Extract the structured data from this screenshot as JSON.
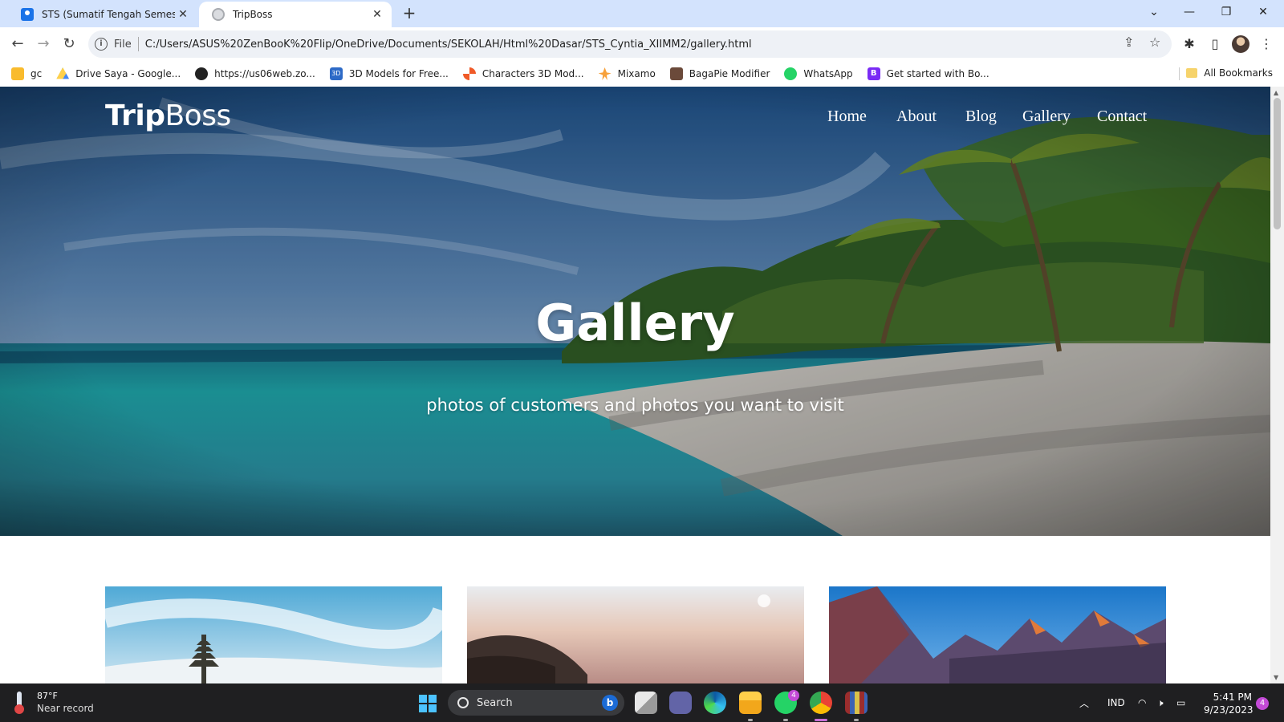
{
  "browser": {
    "tabs": [
      {
        "title": "STS (Sumatif Tengah Semester) C",
        "active": false
      },
      {
        "title": "TripBoss",
        "active": true
      }
    ],
    "address": {
      "scheme": "File",
      "url": "C:/Users/ASUS%20ZenBooK%20Flip/OneDrive/Documents/SEKOLAH/Html%20Dasar/STS_Cyntia_XIIMM2/gallery.html"
    },
    "bookmarks": [
      {
        "label": "gc",
        "icon": "classroom-icon"
      },
      {
        "label": "Drive Saya - Google...",
        "icon": "drive-icon"
      },
      {
        "label": "https://us06web.zo...",
        "icon": "globe-icon"
      },
      {
        "label": "3D Models for Free...",
        "icon": "3d-icon"
      },
      {
        "label": "Characters 3D Mod...",
        "icon": "pinwheel-icon"
      },
      {
        "label": "Mixamo",
        "icon": "mixamo-icon"
      },
      {
        "label": "BagaPie Modifier",
        "icon": "bagapie-icon"
      },
      {
        "label": "WhatsApp",
        "icon": "whatsapp-icon"
      },
      {
        "label": "Get started with Bo...",
        "icon": "bootstrap-icon"
      }
    ],
    "all_bookmarks": "All Bookmarks"
  },
  "site": {
    "logo_bold": "Trip",
    "logo_light": "Boss",
    "nav": [
      "Home",
      "About",
      "Blog",
      "Gallery",
      "Contact"
    ],
    "hero_title": "Gallery",
    "hero_subtitle": "photos of customers and photos you want to visit"
  },
  "taskbar": {
    "weather_temp": "87°F",
    "weather_condition": "Near record",
    "search_placeholder": "Search",
    "language": "IND",
    "time": "5:41 PM",
    "date": "9/23/2023",
    "whatsapp_badge": "4",
    "notification_count": "4"
  },
  "colors": {
    "tabstrip": "#d3e3fd",
    "taskbar": "#1f1f21",
    "accent": "#4cc2ff"
  }
}
